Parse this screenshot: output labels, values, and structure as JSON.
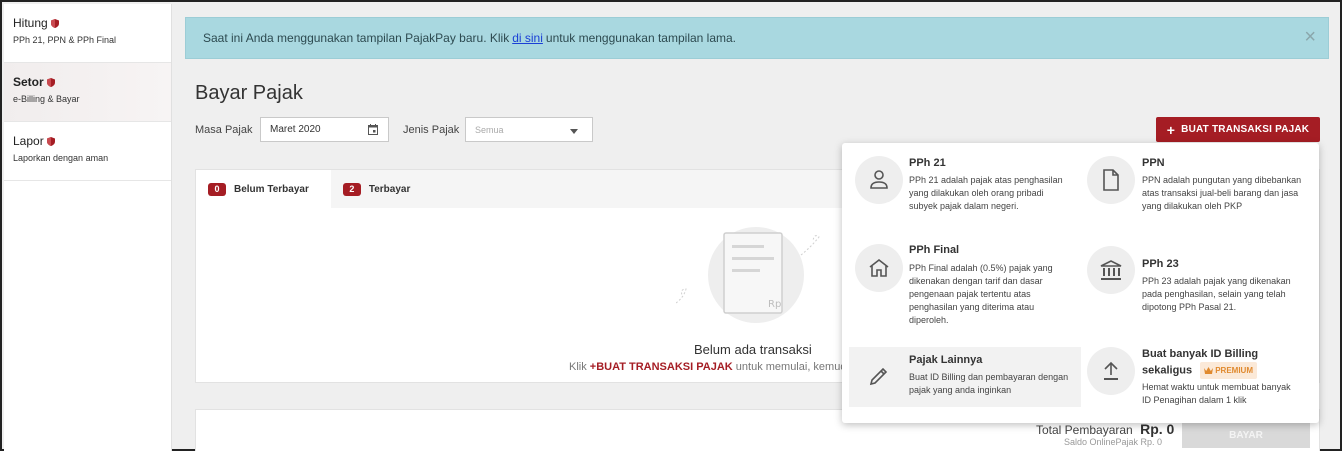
{
  "sidebar": {
    "items": [
      {
        "title": "Hitung",
        "sub": "PPh 21, PPN & PPh Final"
      },
      {
        "title": "Setor",
        "sub": "e-Billing & Bayar"
      },
      {
        "title": "Lapor",
        "sub": "Laporkan dengan aman"
      }
    ]
  },
  "alert": {
    "text_before": "Saat ini Anda menggunakan tampilan PajakPay baru. Klik",
    "link": "di sini",
    "text_after": "untuk menggunakan tampilan lama.",
    "close": "×"
  },
  "page": {
    "title": "Bayar Pajak",
    "masa_label": "Masa Pajak",
    "masa_value": "Maret 2020",
    "jenis_label": "Jenis Pajak",
    "jenis_placeholder": "Semua",
    "create_button": "BUAT TRANSAKSI PAJAK"
  },
  "tabs": [
    {
      "count": "0",
      "label": "Belum Terbayar"
    },
    {
      "count": "2",
      "label": "Terbayar"
    }
  ],
  "empty": {
    "title": "Belum ada transaksi",
    "hint_before": "Klik",
    "hint_link": "+BUAT TRANSAKSI PAJAK",
    "hint_after": "untuk memulai, kemud",
    "rp": "Rp"
  },
  "footer": {
    "total_label": "Total Pembayaran",
    "total_value": "Rp. 0",
    "saldo": "Saldo OnlinePajak Rp. 0",
    "pay_button": "BAYAR"
  },
  "menu": {
    "options": [
      {
        "title": "PPh 21",
        "desc": "PPh 21 adalah pajak atas penghasilan yang dilakukan oleh orang pribadi subyek pajak dalam negeri.",
        "icon": "person-icon"
      },
      {
        "title": "PPN",
        "desc": "PPN adalah pungutan yang dibebankan atas transaksi jual-beli barang dan jasa yang dilakukan oleh PKP",
        "icon": "document-icon"
      },
      {
        "title": "PPh Final",
        "desc": "PPh Final adalah (0.5%) pajak yang dikenakan dengan tarif dan dasar pengenaan pajak tertentu atas penghasilan yang diterima atau diperoleh.",
        "icon": "home-icon"
      },
      {
        "title": "PPh 23",
        "desc": "PPh 23 adalah pajak yang dikenakan pada penghasilan, selain yang telah dipotong PPh Pasal 21.",
        "icon": "bank-icon"
      },
      {
        "title": "Pajak Lainnya",
        "desc": "Buat ID Billing dan pembayaran dengan pajak yang anda inginkan",
        "icon": "pencil-icon"
      },
      {
        "title_line1": "Buat banyak ID Billing",
        "title_line2": "sekaligus",
        "badge": "PREMIUM",
        "desc": "Hemat waktu untuk membuat banyak ID Penagihan dalam 1 klik",
        "icon": "upload-icon"
      }
    ]
  },
  "colors": {
    "brand": "#a51d24",
    "alert_bg": "#a9d8e0",
    "premium": "#e08a2f"
  }
}
